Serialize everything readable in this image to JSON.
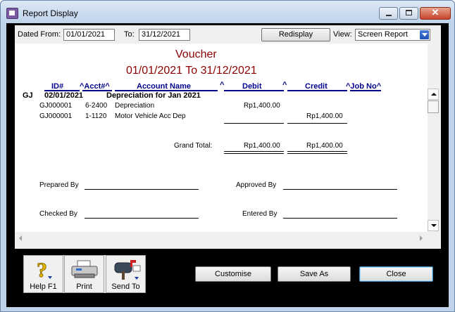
{
  "window": {
    "title": "Report Display"
  },
  "filters": {
    "dated_from_label": "Dated From:",
    "dated_from_value": "01/01/2021",
    "to_label": "To:",
    "to_value": "31/12/2021",
    "redisplay_label": "Redisplay",
    "view_label": "View:",
    "view_value": "Screen Report"
  },
  "report": {
    "title": "Voucher",
    "date_range": "01/01/2021 To 31/12/2021",
    "columns": {
      "id": "ID#",
      "acct": "^Acct#^",
      "account_name": "Account Name",
      "caret1": "^",
      "debit": "Debit",
      "caret2": "^",
      "credit": "Credit",
      "job_no": "^Job No^"
    },
    "entry": {
      "type": "GJ",
      "date": "02/01/2021",
      "description": "Depreciation for Jan 2021",
      "lines": [
        {
          "id": "GJ000001",
          "acct": "6-2400",
          "name": "Depreciation",
          "debit": "Rp1,400.00",
          "credit": ""
        },
        {
          "id": "GJ000001",
          "acct": "1-1120",
          "name": "Motor Vehicle Acc Dep",
          "debit": "",
          "credit": "Rp1,400.00"
        }
      ]
    },
    "grand_total_label": "Grand Total:",
    "grand_total_debit": "Rp1,400.00",
    "grand_total_credit": "Rp1,400.00",
    "signatures": {
      "prepared_by": "Prepared By",
      "approved_by": "Approved By",
      "checked_by": "Checked By",
      "entered_by": "Entered By"
    }
  },
  "actions": {
    "help": "Help F1",
    "print": "Print",
    "send_to": "Send To",
    "customise": "Customise",
    "save_as": "Save As",
    "close": "Close"
  },
  "colors": {
    "report_title": "#8b0000",
    "column_header": "#00008b"
  }
}
